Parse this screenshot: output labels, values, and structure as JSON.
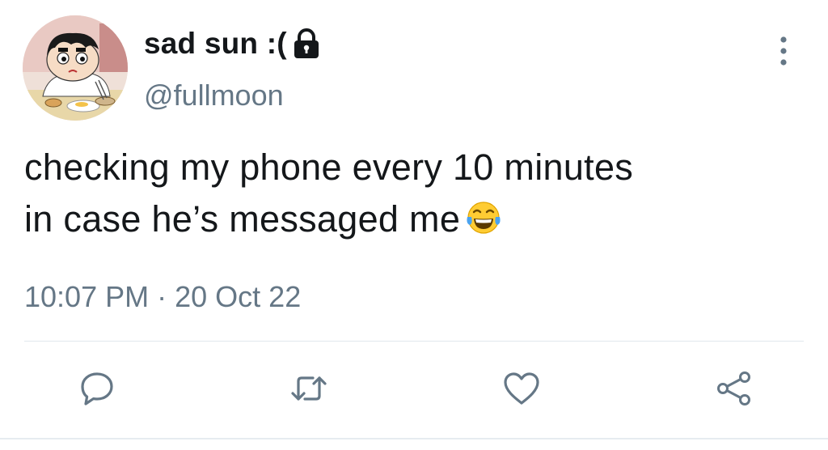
{
  "tweet": {
    "display_name": "sad sun :(",
    "handle": "@fullmoon",
    "text_line_1": "checking my phone every 10 minutes",
    "text_line_2": "in case he’s messaged me",
    "emoji": "face-with-tears-of-joy-icon",
    "time": "10:07 PM",
    "separator": "·",
    "date": "20 Oct 22",
    "protected": true
  },
  "actions": [
    {
      "name": "reply",
      "icon": "comment-icon"
    },
    {
      "name": "retweet",
      "icon": "retweet-icon"
    },
    {
      "name": "like",
      "icon": "heart-icon"
    },
    {
      "name": "share",
      "icon": "share-icon"
    }
  ],
  "colors": {
    "text": "#14171a",
    "secondary": "#657786",
    "icon": "#657786",
    "divider": "#e1e8ed"
  }
}
